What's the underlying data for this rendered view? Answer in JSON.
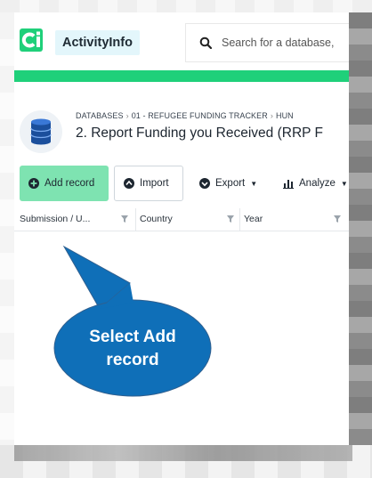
{
  "header": {
    "brand": "ActivityInfo",
    "search": {
      "placeholder": "Search for a database,"
    }
  },
  "breadcrumb": [
    "DATABASES",
    "01 - REFUGEE FUNDING TRACKER",
    "HUN"
  ],
  "page_title": "2. Report Funding you Received (RRP F",
  "toolbar": {
    "add_label": "Add record",
    "import_label": "Import",
    "export_label": "Export",
    "analyze_label": "Analyze"
  },
  "table": {
    "columns": [
      "Submission / U...",
      "Country",
      "Year"
    ]
  },
  "callout": {
    "line1": "Select Add",
    "line2": "record"
  },
  "colors": {
    "accent_green": "#1fd07a",
    "add_button": "#7ee3b1",
    "callout_blue": "#0f6fb8",
    "brand_bg": "#e3f6fb"
  },
  "icons": [
    "activityinfo-logo-icon",
    "search-icon",
    "database-icon",
    "plus-circle-icon",
    "upload-icon",
    "download-icon",
    "bar-chart-icon",
    "filter-icon"
  ]
}
